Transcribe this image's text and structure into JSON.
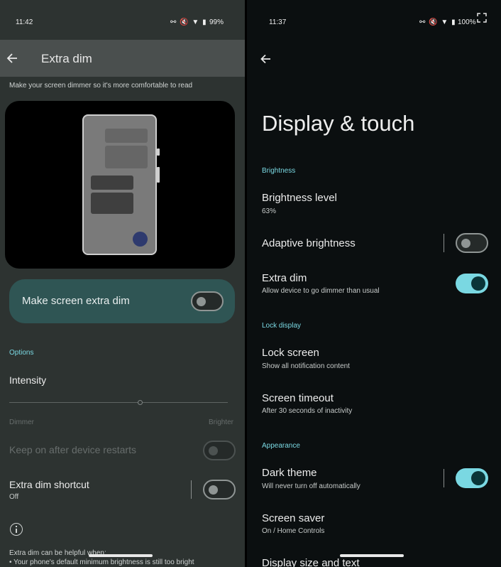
{
  "left": {
    "status": {
      "time": "11:42",
      "icons": "⚯ 🔇 ▼ ▮",
      "battery": "99%"
    },
    "appbar": {
      "title": "Extra dim"
    },
    "subtitle": "Make your screen dimmer so it's more comfortable to read",
    "main_toggle": {
      "label": "Make screen extra dim",
      "state": "off"
    },
    "options_header": "Options",
    "intensity": {
      "title": "Intensity",
      "min_label": "Dimmer",
      "max_label": "Brighter",
      "level": 0.6
    },
    "keep_on": {
      "title": "Keep on after device restarts",
      "state": "off",
      "disabled": true
    },
    "shortcut": {
      "title": "Extra dim shortcut",
      "subtitle": "Off",
      "state": "off"
    },
    "footer": {
      "line1": "Extra dim can be helpful when:",
      "line2": "• Your phone's default minimum brightness is still too bright"
    }
  },
  "right": {
    "status": {
      "time": "11:37",
      "icons": "⚯ 🔇 ▼ ▮",
      "battery": "100%"
    },
    "title": "Display & touch",
    "sections": {
      "brightness": "Brightness",
      "lock_display": "Lock display",
      "appearance": "Appearance"
    },
    "rows": {
      "brightness_level": {
        "title": "Brightness level",
        "subtitle": "63%"
      },
      "adaptive_brightness": {
        "title": "Adaptive brightness",
        "state": "off"
      },
      "extra_dim": {
        "title": "Extra dim",
        "subtitle": "Allow device to go dimmer than usual",
        "state": "on"
      },
      "lock_screen": {
        "title": "Lock screen",
        "subtitle": "Show all notification content"
      },
      "screen_timeout": {
        "title": "Screen timeout",
        "subtitle": "After 30 seconds of inactivity"
      },
      "dark_theme": {
        "title": "Dark theme",
        "subtitle": "Will never turn off automatically",
        "state": "on"
      },
      "screen_saver": {
        "title": "Screen saver",
        "subtitle": "On / Home Controls"
      },
      "display_size": {
        "title": "Display size and text"
      }
    }
  },
  "colors": {
    "accent": "#7ad8e2",
    "card": "#2f5554",
    "left_bg": "#2d3331",
    "right_bg": "#0b0f10"
  }
}
